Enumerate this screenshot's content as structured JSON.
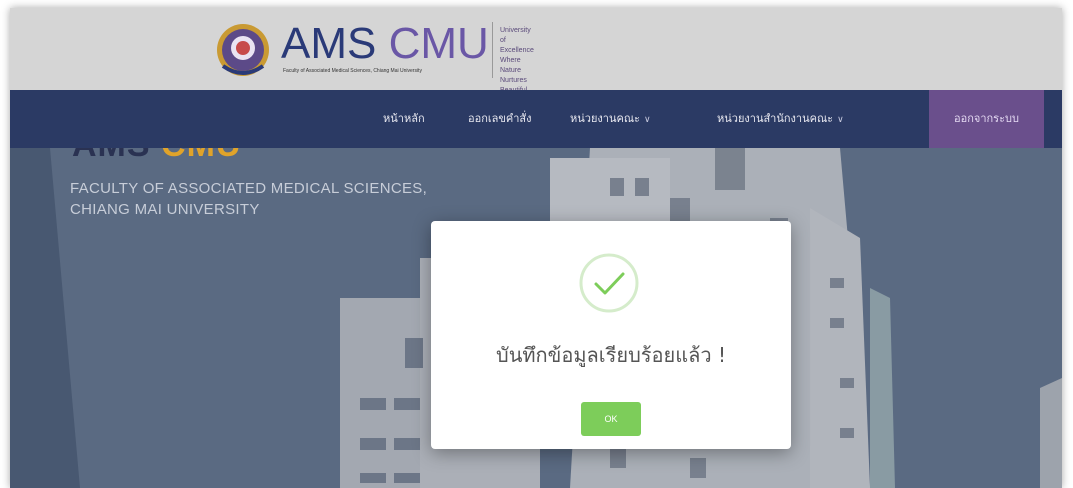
{
  "header": {
    "brand_ams": "AMS",
    "brand_cmu": "CMU",
    "brand_subtitle": "Faculty of Associated Medical Sciences, Chiang Mai University",
    "tagline_lines": [
      "University of Excellence",
      "Where Nature Nurtures",
      "Beautiful Intelligence"
    ]
  },
  "nav": {
    "items": [
      {
        "label": "หน้าหลัก"
      },
      {
        "label": "ออกเลขคำสั่ง"
      },
      {
        "label": "หน่วยงานคณะ"
      },
      {
        "label": "หน่วยงานสำนักงานคณะ"
      }
    ],
    "logout": "ออกจากระบบ"
  },
  "hero": {
    "title_a": "AMS",
    "title_c": "CMU",
    "subtitle_line1": "FACULTY OF ASSOCIATED MEDICAL SCIENCES,",
    "subtitle_line2": "CHIANG MAI UNIVERSITY"
  },
  "modal": {
    "message": "บันทึกข้อมูลเรียบร้อยแล้ว !",
    "ok_label": "OK",
    "icon": "check-circle-icon",
    "accent": "#7dcd5a"
  }
}
